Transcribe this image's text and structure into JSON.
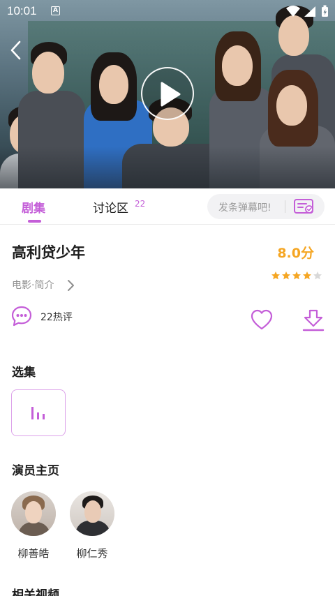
{
  "status_bar": {
    "time": "10:01",
    "notification_badge": "A",
    "icons": [
      "wifi-icon",
      "signal-icon",
      "battery-icon"
    ]
  },
  "video": {
    "back_icon": "back-arrow-icon",
    "play_icon": "play-icon"
  },
  "tabs": [
    {
      "label": "剧集",
      "active": true
    },
    {
      "label": "讨论区",
      "count": "22",
      "active": false
    }
  ],
  "danmu": {
    "placeholder": "发条弹幕吧!",
    "icon": "danmu-send-icon"
  },
  "show": {
    "title": "高利贷少年",
    "score": "8.0分",
    "stars_filled": 4,
    "stars_total": 5,
    "meta": "电影·简介"
  },
  "actions": {
    "comments_label": "22热评",
    "comment_icon": "comment-bubble-icon",
    "favorite_icon": "heart-icon",
    "download_icon": "download-icon"
  },
  "sections": {
    "episodes": "选集",
    "actors": "演员主页",
    "related": "相关视频"
  },
  "episode_card": {
    "icon": "playing-bars-icon"
  },
  "actors": [
    {
      "name": "柳善皓"
    },
    {
      "name": "柳仁秀"
    }
  ],
  "colors": {
    "accent": "#c45ed8",
    "score": "#f5a623",
    "muted": "#8e8e8e"
  }
}
